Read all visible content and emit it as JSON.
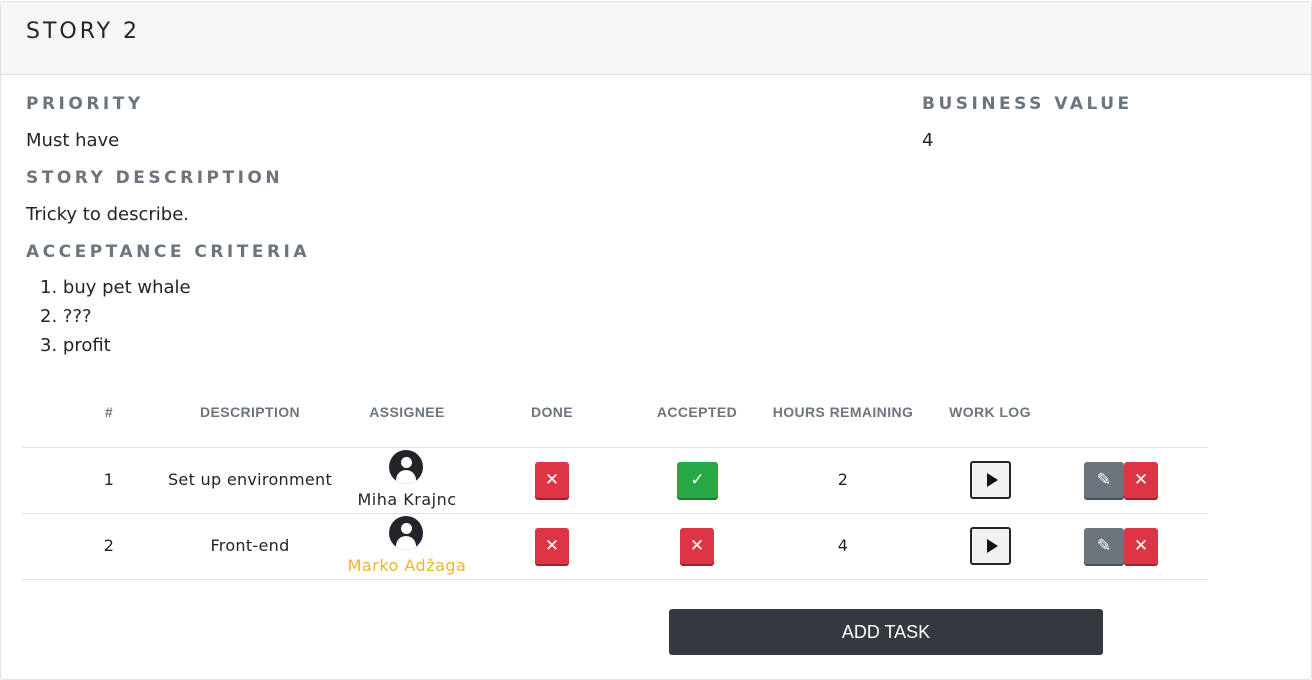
{
  "story": {
    "title": "STORY 2",
    "priority_label": "PRIORITY",
    "priority_value": "Must have",
    "business_value_label": "BUSINESS VALUE",
    "business_value": "4",
    "description_label": "STORY DESCRIPTION",
    "description": "Tricky to describe.",
    "criteria_label": "ACCEPTANCE CRITERIA",
    "criteria": [
      "1. buy pet whale",
      "2. ???",
      "3. profit"
    ]
  },
  "table": {
    "headers": [
      "#",
      "DESCRIPTION",
      "ASSIGNEE",
      "DONE",
      "ACCEPTED",
      "HOURS REMAINING",
      "WORK LOG"
    ],
    "rows": [
      {
        "num": "1",
        "description": "Set up environment",
        "assignee": "Miha Krajnc",
        "assignee_color": "#212529",
        "done": "✕",
        "accepted": "✓",
        "hours": "2"
      },
      {
        "num": "2",
        "description": "Front-end",
        "assignee": "Marko Adžaga",
        "assignee_color": "#f0b429",
        "done": "✕",
        "accepted": "✕",
        "hours": "4"
      }
    ]
  },
  "buttons": {
    "add_task": "ADD TASK",
    "edit_icon": "✎",
    "delete_icon": "✕"
  },
  "colors": {
    "danger": "#dc3545",
    "success": "#28a745",
    "secondary": "#6c757d",
    "dark": "#343a40",
    "warning_name": "#f0b429"
  }
}
